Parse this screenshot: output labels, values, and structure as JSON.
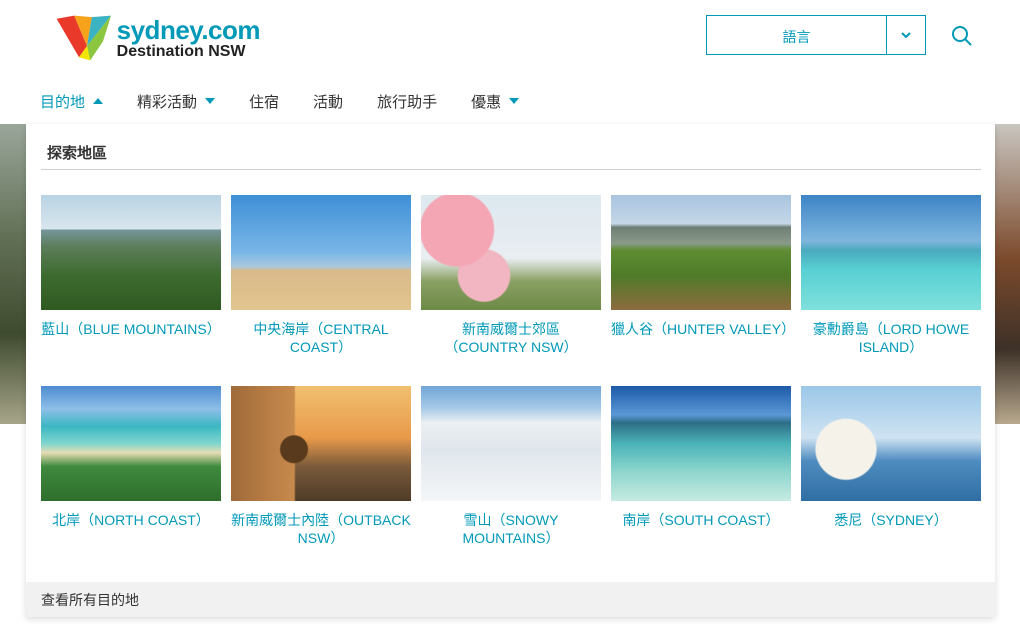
{
  "logo": {
    "line1": "sydney.com",
    "line2": "Destination NSW"
  },
  "language_select": {
    "value": "語言"
  },
  "nav": {
    "items": [
      {
        "label": "目的地",
        "caret": "up",
        "active": true
      },
      {
        "label": "精彩活動",
        "caret": "down",
        "active": false
      },
      {
        "label": "住宿",
        "caret": "",
        "active": false
      },
      {
        "label": "活動",
        "caret": "",
        "active": false
      },
      {
        "label": "旅行助手",
        "caret": "",
        "active": false
      },
      {
        "label": "優惠",
        "caret": "down",
        "active": false
      }
    ]
  },
  "panel": {
    "title": "探索地區",
    "regions": [
      {
        "label": "藍山（BLUE MOUNTAINS）",
        "photo": "blue-mountains-photo"
      },
      {
        "label": "中央海岸（CENTRAL COAST）",
        "photo": "central-coast-photo"
      },
      {
        "label": "新南威爾士郊區（COUNTRY NSW）",
        "photo": "country-nsw-photo"
      },
      {
        "label": "獵人谷（HUNTER VALLEY）",
        "photo": "hunter-valley-photo"
      },
      {
        "label": "豪勳爵島（LORD HOWE ISLAND）",
        "photo": "lord-howe-island-photo"
      },
      {
        "label": "北岸（NORTH COAST）",
        "photo": "north-coast-photo"
      },
      {
        "label": "新南威爾士內陸（OUTBACK NSW）",
        "photo": "outback-nsw-photo"
      },
      {
        "label": "雪山（SNOWY MOUNTAINS）",
        "photo": "snowy-mountains-photo"
      },
      {
        "label": "南岸（SOUTH COAST）",
        "photo": "south-coast-photo"
      },
      {
        "label": "悉尼（SYDNEY）",
        "photo": "sydney-photo"
      }
    ],
    "footer_link": "查看所有目的地"
  },
  "colors": {
    "accent": "#0099b8",
    "text": "#333333",
    "footer_bg": "#f1f1f1",
    "rule": "#cfcfcf"
  }
}
